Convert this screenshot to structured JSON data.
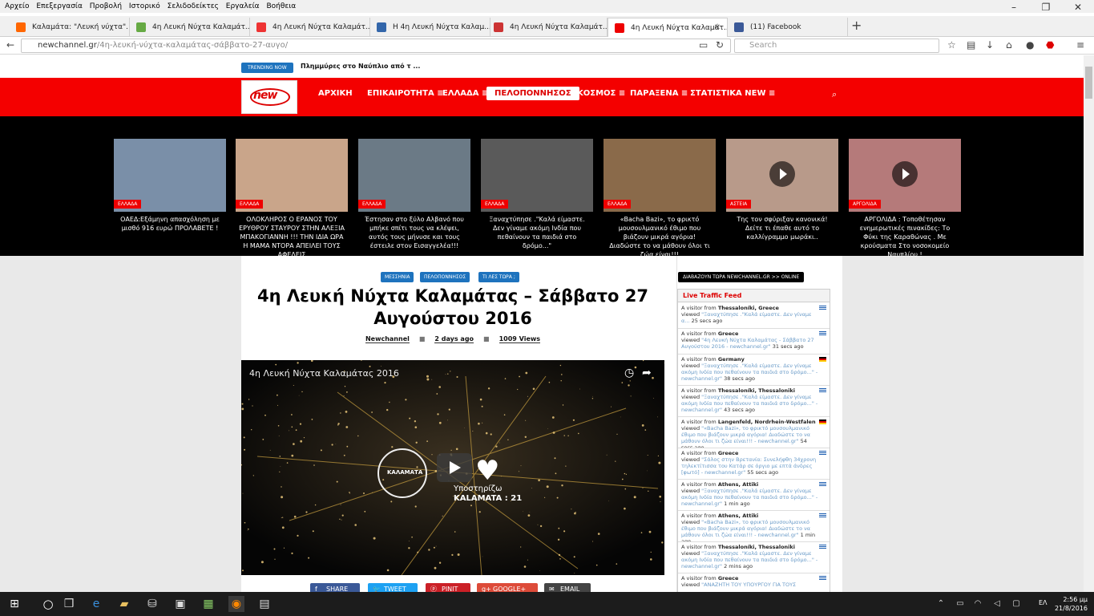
{
  "menubar": [
    "Αρχείο",
    "Επεξεργασία",
    "Προβολή",
    "Ιστορικό",
    "Σελιδοδείκτες",
    "Εργαλεία",
    "Βοήθεια"
  ],
  "tabs": [
    {
      "label": "Καλαμάτα: \"Λευκή νύχτα\"...",
      "color": "#f60"
    },
    {
      "label": "4η Λευκή Νύχτα Καλαμάτ...",
      "color": "#6a4"
    },
    {
      "label": "4η Λευκή Νύχτα Καλαμάτ...",
      "color": "#e33"
    },
    {
      "label": "Η 4η Λευκή Νύχτα Καλαμ...",
      "color": "#36a"
    },
    {
      "label": "4η Λευκή Νύχτα Καλαμάτ...",
      "color": "#c33"
    },
    {
      "label": "4η Λευκή Νύχτα Καλαμάτ...",
      "color": "#e00"
    },
    {
      "label": "(11) Facebook",
      "color": "#3b5998"
    }
  ],
  "url": {
    "domain": "newchannel.gr",
    "path": "/4η-λευκή-νύχτα-καλαμάτας-σάββατο-27-αυγο/"
  },
  "search_placeholder": "Search",
  "trending": {
    "badge": "TRENDING NOW",
    "text": "Πλημμύρες στο Ναύπλιο από τ ..."
  },
  "nav": [
    "ΑΡΧΙΚΗ",
    "ΕΠΙΚΑΙΡΟΤΗΤΑ ≡",
    "ΕΛΛΑΔΑ ≡",
    "ΠΕΛΟΠΟΝΝΗΣΟΣ",
    "ΚΟΣΜΟΣ ≡",
    "ΠΑΡΑΞΕΝΑ ≡",
    "ΣΤΑΤΙΣΤΙΚΑ NEW ≡"
  ],
  "logo": "new",
  "cards": [
    {
      "cat": "ΕΛΛΑΔΑ",
      "cap": "ΟΑΕΔ:Εξάμηνη απασχόληση με μισθό 916 ευρώ ΠΡΟΛΑΒΕΤΕ !",
      "color": "#7a8fa8",
      "play": false
    },
    {
      "cat": "ΕΛΛΑΔΑ",
      "cap": "ΟΛΟΚΛΗΡΟΣ Ο ΕΡΑΝΟΣ ΤΟΥ ΕΡΥΘΡΟΥ ΣΤΑΥΡΟΥ ΣΤΗΝ ΑΛΕΞΙΑ ΜΠΑΚΟΓΙΑΝΝΗ !!! ΤΗΝ ΙΔΙΑ ΩΡΑ Η ΜΑΜΑ ΝΤΟΡΑ ΑΠΕΙΛΕΙ ΤΟΥΣ ΑΦΕΛΕΙΣ",
      "color": "#c9a58a",
      "play": false
    },
    {
      "cat": "ΕΛΛΑΔΑ",
      "cap": "Έστησαν στο ξύλο Αλβανό που μπήκε σπίτι τους να κλέψει, αυτός τους μήνυσε και τους έστειλε στον Εισαγγελέα!!!",
      "color": "#6b7a86",
      "play": false
    },
    {
      "cat": "ΕΛΛΑΔΑ",
      "cap": "Ξαναχτύπησε .\"Καλά είμαστε. Δεν γίναμε ακόμη Ινδία που πεθαίνουν τα παιδιά στο δρόμο...\"",
      "color": "#5a5a5a",
      "play": false
    },
    {
      "cat": "ΕΛΛΑΔΑ",
      "cap": "«Bacha Bazi», το φρικτό μουσουλμανικό έθιμο που βιάζουν μικρά αγόρια! Διαδώστε το να μάθουν όλοι τι ζώα είναι!!!",
      "color": "#8a6a4a",
      "play": false
    },
    {
      "cat": "ΑΣΤΕΙΑ",
      "cap": "Της τον σφύριξαν κανονικά! Δείτε τι έπαθε αυτό το καλλίγραμμο μωράκι..",
      "color": "#b89a8a",
      "play": true
    },
    {
      "cat": "ΑΡΓΟΛΙΔΑ",
      "cap": "ΑΡΓΟΛΙΔΑ : Τοποθέτησαν ενημερωτικές πινακίδες: Το Φύκι της Καραθώνας . Με κρούσματα Στο νοσοκομείο Ναυπλίου !",
      "color": "#b57a7a",
      "play": true
    }
  ],
  "tags": [
    "ΜΕΣΣΗΝΙΑ",
    "ΠΕΛΟΠΟΝΝΗΣΟΣ",
    "ΤΙ ΛΕΣ ΤΩΡΑ ;"
  ],
  "article": {
    "title": "4η Λευκή Νύχτα Καλαμάτας – Σάββατο 27 Αυγούστου 2016",
    "author": "Newchannel",
    "date": "2 days ago",
    "views": "1009 Views"
  },
  "video": {
    "title": "4η Λευκή Νύχτα Καλαμάτας 2016",
    "badge": "ΚΑΛΑΜΑΤΑ",
    "support": "Υποστηρίζω",
    "support2": "KALAMATA : 21"
  },
  "share": [
    {
      "label": "SHARE",
      "color": "#3b5998"
    },
    {
      "label": "TWEET",
      "color": "#1da1f2"
    },
    {
      "label": "PINIT",
      "color": "#cb2027"
    },
    {
      "label": "GOOGLE+",
      "color": "#dd4b39"
    },
    {
      "label": "EMAIL",
      "color": "#444"
    }
  ],
  "readnow": "ΔΙΑΒΑΖΟΥΝ ΤΩΡΑ NEWCHANNEL.GR >> ONLINE",
  "feed": {
    "title": "Live Traffic Feed",
    "items": [
      {
        "from": "Thessaloníki, Greece",
        "text": "\"Ξαναχτύπησε .\"Καλά είμαστε. Δεν γίναμε α...",
        "time": "25 secs ago",
        "flag": "gr"
      },
      {
        "from": "Greece",
        "text": "\"4η Λευκή Νύχτα Καλαμάτας - Σάββατο 27 Αυγούστου 2016 - newchannel.gr\"",
        "time": "31 secs ago",
        "flag": "gr"
      },
      {
        "from": "Germany",
        "text": "\"Ξαναχτύπησε .\"Καλά είμαστε. Δεν γίναμε ακόμη Ινδία που πεθαίνουν τα παιδιά στο δρόμο...\" - newchannel.gr\"",
        "time": "38 secs ago",
        "flag": "de"
      },
      {
        "from": "Thessaloníki, Thessaloniki",
        "text": "\"Ξαναχτύπησε .\"Καλά είμαστε. Δεν γίναμε ακόμη Ινδία που πεθαίνουν τα παιδιά στο δρόμο...\" - newchannel.gr\"",
        "time": "43 secs ago",
        "flag": "gr"
      },
      {
        "from": "Langenfeld, Nordrhein-Westfalen",
        "text": "\"«Bacha Bazi», το φρικτό μουσουλμανικό έθιμο που βιάζουν μικρά αγόρια! Διαδώστε το να μάθουν όλοι τι ζώα είναι!!! - newchannel.gr\"",
        "time": "54 secs ago",
        "flag": "de"
      },
      {
        "from": "Greece",
        "text": "\"Σάλος στην Βρετανία: Συνελήφθη 34χρονη τηλεκτίτισσα του Κατάρ σε όργιο με επτά άνδρες [φωτό] - newchannel.gr\"",
        "time": "55 secs ago",
        "flag": "gr"
      },
      {
        "from": "Athens, Attiki",
        "text": "\"Ξαναχτύπησε .\"Καλά είμαστε. Δεν γίναμε ακόμη Ινδία που πεθαίνουν τα παιδιά στο δρόμο...\" - newchannel.gr\"",
        "time": "1 min ago",
        "flag": "gr"
      },
      {
        "from": "Athens, Attiki",
        "text": "\"«Bacha Bazi», το φρικτό μουσουλμανικό έθιμο που βιάζουν μικρά αγόρια! Διαδώστε το να μάθουν όλοι τι ζώα είναι!!! - newchannel.gr\"",
        "time": "1 min ago",
        "flag": "gr"
      },
      {
        "from": "Thessaloníki, Thessaloniki",
        "text": "\"Ξαναχτύπησε .\"Καλά είμαστε. Δεν γίναμε ακόμη Ινδία που πεθαίνουν τα παιδιά στο δρόμο...\" - newchannel.gr\"",
        "time": "2 mins ago",
        "flag": "gr"
      },
      {
        "from": "Greece",
        "text": "\"ΑΝΑΖΗΤΗ ΤΟΥ ΥΠΟΥΡΓΟΥ ΓΙΑ ΤΟΥΣ",
        "time": "",
        "flag": "gr"
      }
    ]
  },
  "feed_prefix": "A visitor from",
  "feed_viewed": "viewed",
  "taskbar": {
    "lang": "ΕΛ",
    "time": "2:56 μμ",
    "date": "21/8/2016"
  }
}
